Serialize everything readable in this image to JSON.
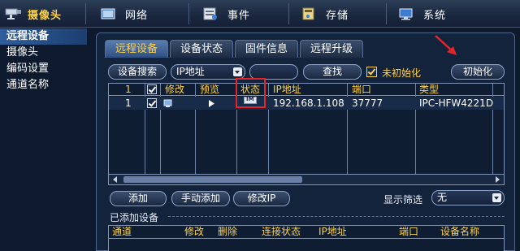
{
  "topbar": {
    "home_label": "摄像头",
    "items": [
      {
        "label": "网络",
        "icon": "network-icon"
      },
      {
        "label": "事件",
        "icon": "event-icon"
      },
      {
        "label": "存储",
        "icon": "storage-icon"
      },
      {
        "label": "系统",
        "icon": "system-icon"
      }
    ]
  },
  "sidebar": {
    "items": [
      {
        "label": "远程设备",
        "active": true
      },
      {
        "label": "摄像头",
        "active": false
      },
      {
        "label": "编码设置",
        "active": false
      },
      {
        "label": "通道名称",
        "active": false
      }
    ]
  },
  "tabs": [
    {
      "label": "远程设备",
      "active": true
    },
    {
      "label": "设备状态",
      "active": false
    },
    {
      "label": "固件信息",
      "active": false
    },
    {
      "label": "远程升级",
      "active": false
    }
  ],
  "toolbar": {
    "search_device_label": "设备搜索",
    "filter_select_value": "IP地址",
    "search_field_value": "",
    "find_label": "查找",
    "uninit_checkbox_label": "未初始化",
    "uninit_checked": true,
    "init_label": "初始化"
  },
  "device_table": {
    "headers": {
      "index": "1",
      "modify": "修改",
      "preview": "预览",
      "status": "状态",
      "ip": "IP地址",
      "port": "端口",
      "type": "类型"
    },
    "rows": [
      {
        "index": "1",
        "checked": true,
        "ip": "192.168.1.108",
        "port": "37777",
        "type": "IPC-HFW4221D"
      }
    ]
  },
  "actions": {
    "add_label": "添加",
    "manual_add_label": "手动添加",
    "modify_ip_label": "修改IP",
    "display_filter_label": "显示筛选",
    "display_filter_value": "无"
  },
  "added_section": {
    "title": "已添加设备",
    "headers": {
      "channel": "通道",
      "modify": "修改",
      "delete": "删除",
      "conn_status": "连接状态",
      "ip": "IP地址",
      "port": "端口",
      "device_name": "设备名称"
    }
  },
  "colors": {
    "accent_yellow": "#ffd24a",
    "highlight_red": "#e0262b",
    "panel_bg": "#13233b",
    "active_tab": "#3e6aa6"
  }
}
